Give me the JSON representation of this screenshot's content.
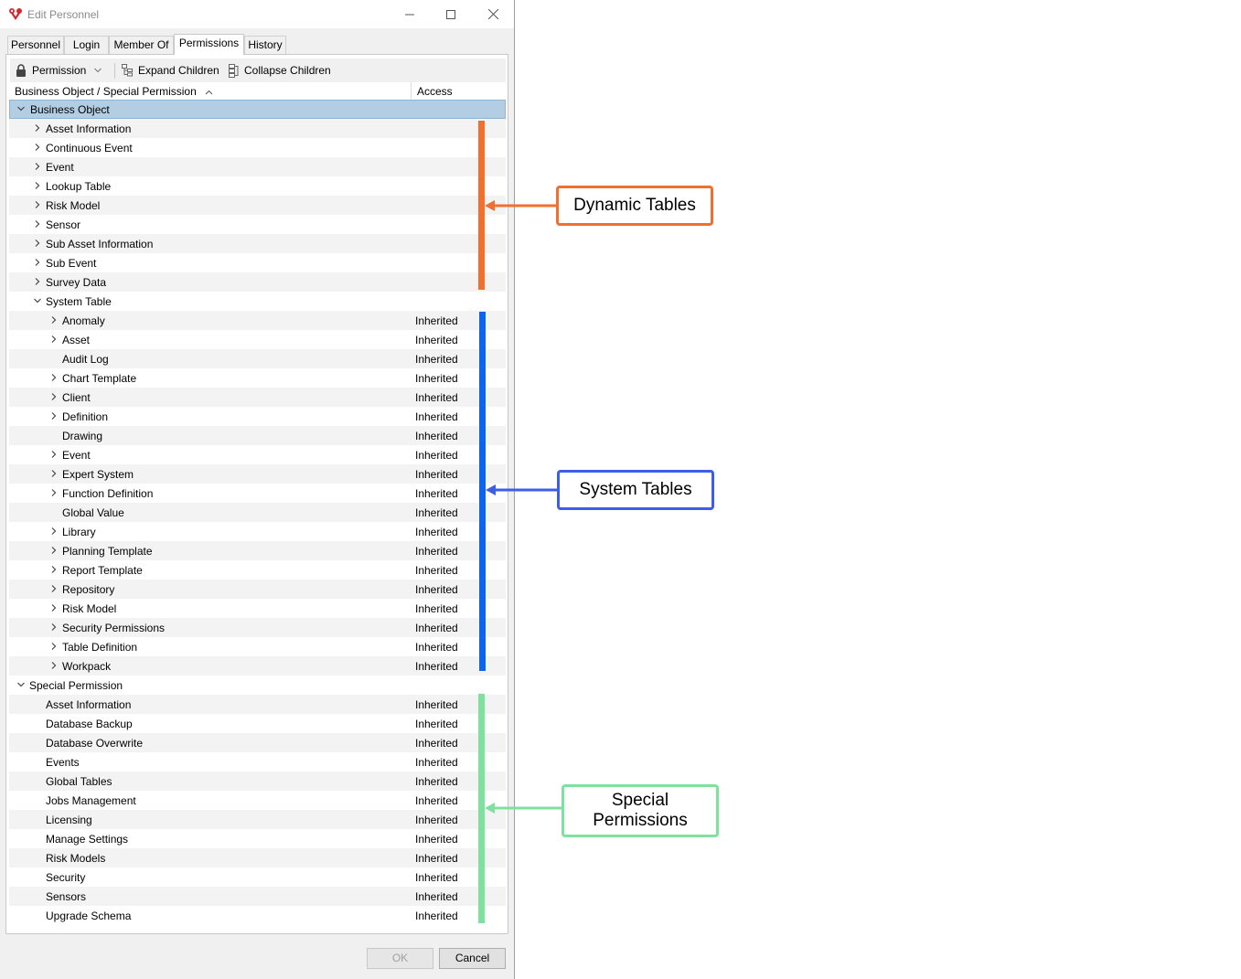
{
  "window": {
    "title": "Edit Personnel",
    "brand_color": "#d9272e"
  },
  "tabs": [
    {
      "label": "Personnel"
    },
    {
      "label": "Login"
    },
    {
      "label": "Member Of"
    },
    {
      "label": "Permissions",
      "active": true
    },
    {
      "label": "History"
    }
  ],
  "toolbar": {
    "permission_label": "Permission",
    "expand_label": "Expand Children",
    "collapse_label": "Collapse Children"
  },
  "columns": {
    "name": "Business Object / Special Permission",
    "access": "Access"
  },
  "tree": [
    {
      "level": 0,
      "label": "Business Object",
      "expander": "open",
      "access": "",
      "selected": true
    },
    {
      "level": 1,
      "label": "Asset Information",
      "expander": "closed",
      "access": ""
    },
    {
      "level": 1,
      "label": "Continuous Event",
      "expander": "closed",
      "access": ""
    },
    {
      "level": 1,
      "label": "Event",
      "expander": "closed",
      "access": ""
    },
    {
      "level": 1,
      "label": "Lookup Table",
      "expander": "closed",
      "access": ""
    },
    {
      "level": 1,
      "label": "Risk Model",
      "expander": "closed",
      "access": ""
    },
    {
      "level": 1,
      "label": "Sensor",
      "expander": "closed",
      "access": ""
    },
    {
      "level": 1,
      "label": "Sub Asset Information",
      "expander": "closed",
      "access": ""
    },
    {
      "level": 1,
      "label": "Sub Event",
      "expander": "closed",
      "access": ""
    },
    {
      "level": 1,
      "label": "Survey Data",
      "expander": "closed",
      "access": ""
    },
    {
      "level": 1,
      "label": "System Table",
      "expander": "open",
      "access": ""
    },
    {
      "level": 2,
      "label": "Anomaly",
      "expander": "closed",
      "access": "Inherited"
    },
    {
      "level": 2,
      "label": "Asset",
      "expander": "closed",
      "access": "Inherited"
    },
    {
      "level": 2,
      "label": "Audit Log",
      "expander": "none",
      "access": "Inherited"
    },
    {
      "level": 2,
      "label": "Chart Template",
      "expander": "closed",
      "access": "Inherited"
    },
    {
      "level": 2,
      "label": "Client",
      "expander": "closed",
      "access": "Inherited"
    },
    {
      "level": 2,
      "label": "Definition",
      "expander": "closed",
      "access": "Inherited"
    },
    {
      "level": 2,
      "label": "Drawing",
      "expander": "none",
      "access": "Inherited"
    },
    {
      "level": 2,
      "label": "Event",
      "expander": "closed",
      "access": "Inherited"
    },
    {
      "level": 2,
      "label": "Expert System",
      "expander": "closed",
      "access": "Inherited"
    },
    {
      "level": 2,
      "label": "Function Definition",
      "expander": "closed",
      "access": "Inherited"
    },
    {
      "level": 2,
      "label": "Global Value",
      "expander": "none",
      "access": "Inherited"
    },
    {
      "level": 2,
      "label": "Library",
      "expander": "closed",
      "access": "Inherited"
    },
    {
      "level": 2,
      "label": "Planning Template",
      "expander": "closed",
      "access": "Inherited"
    },
    {
      "level": 2,
      "label": "Report Template",
      "expander": "closed",
      "access": "Inherited"
    },
    {
      "level": 2,
      "label": "Repository",
      "expander": "closed",
      "access": "Inherited"
    },
    {
      "level": 2,
      "label": "Risk Model",
      "expander": "closed",
      "access": "Inherited"
    },
    {
      "level": 2,
      "label": "Security Permissions",
      "expander": "closed",
      "access": "Inherited"
    },
    {
      "level": 2,
      "label": "Table Definition",
      "expander": "closed",
      "access": "Inherited"
    },
    {
      "level": 2,
      "label": "Workpack",
      "expander": "closed",
      "access": "Inherited"
    },
    {
      "level": 0,
      "label": "Special Permission",
      "expander": "open",
      "access": ""
    },
    {
      "level": 1,
      "label": "Asset Information",
      "expander": "none",
      "access": "Inherited"
    },
    {
      "level": 1,
      "label": "Database Backup",
      "expander": "none",
      "access": "Inherited"
    },
    {
      "level": 1,
      "label": "Database Overwrite",
      "expander": "none",
      "access": "Inherited"
    },
    {
      "level": 1,
      "label": "Events",
      "expander": "none",
      "access": "Inherited"
    },
    {
      "level": 1,
      "label": "Global Tables",
      "expander": "none",
      "access": "Inherited"
    },
    {
      "level": 1,
      "label": "Jobs Management",
      "expander": "none",
      "access": "Inherited"
    },
    {
      "level": 1,
      "label": "Licensing",
      "expander": "none",
      "access": "Inherited"
    },
    {
      "level": 1,
      "label": "Manage Settings",
      "expander": "none",
      "access": "Inherited"
    },
    {
      "level": 1,
      "label": "Risk Models",
      "expander": "none",
      "access": "Inherited"
    },
    {
      "level": 1,
      "label": "Security",
      "expander": "none",
      "access": "Inherited"
    },
    {
      "level": 1,
      "label": "Sensors",
      "expander": "none",
      "access": "Inherited"
    },
    {
      "level": 1,
      "label": "Upgrade Schema",
      "expander": "none",
      "access": "Inherited"
    }
  ],
  "buttons": {
    "ok": "OK",
    "cancel": "Cancel"
  },
  "annotations": {
    "dynamic": {
      "label": "Dynamic Tables",
      "color": "#f07030"
    },
    "system": {
      "label": "System Tables",
      "color": "#3d5ce8",
      "bar_color": "#0a66ee"
    },
    "special": {
      "label_line1": "Special",
      "label_line2": "Permissions",
      "color": "#7fe0a0"
    }
  }
}
